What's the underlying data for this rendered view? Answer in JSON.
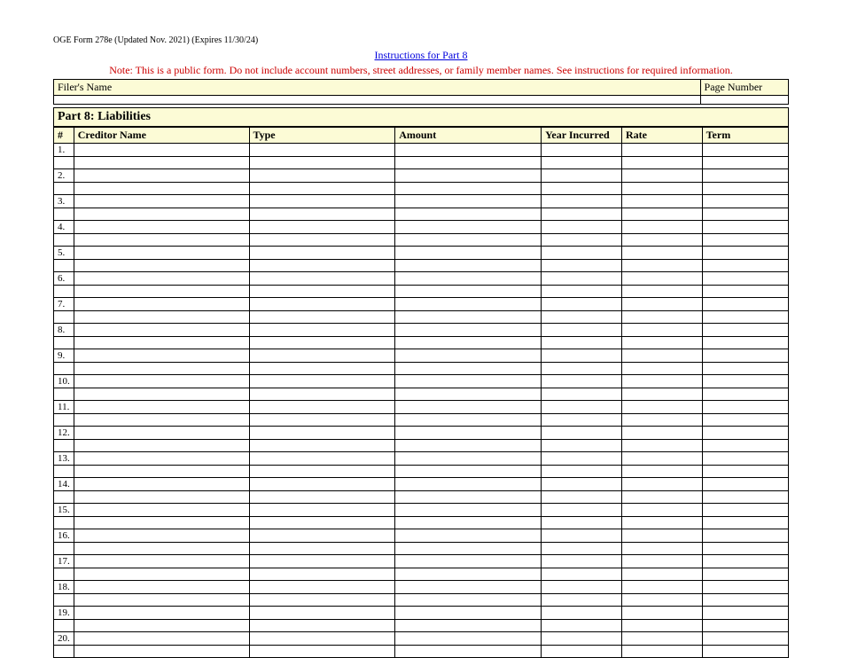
{
  "header": {
    "form_meta": "OGE Form 278e (Updated Nov. 2021) (Expires 11/30/24)",
    "instructions_link": "Instructions for Part 8",
    "note": "Note: This is a public form. Do not include account numbers, street addresses, or family member names.  See instructions for required information."
  },
  "filer_section": {
    "filer_name_label": "Filer's Name",
    "page_number_label": "Page Number",
    "filer_name_value": "",
    "page_number_value": ""
  },
  "section": {
    "title": "Part 8: Liabilities"
  },
  "columns": {
    "num": "#",
    "creditor": "Creditor Name",
    "type": "Type",
    "amount": "Amount",
    "year": "Year Incurred",
    "rate": "Rate",
    "term": "Term"
  },
  "rows": [
    {
      "num": "1.",
      "creditor": "",
      "type": "",
      "amount": "",
      "year": "",
      "rate": "",
      "term": ""
    },
    {
      "num": "2.",
      "creditor": "",
      "type": "",
      "amount": "",
      "year": "",
      "rate": "",
      "term": ""
    },
    {
      "num": "3.",
      "creditor": "",
      "type": "",
      "amount": "",
      "year": "",
      "rate": "",
      "term": ""
    },
    {
      "num": "4.",
      "creditor": "",
      "type": "",
      "amount": "",
      "year": "",
      "rate": "",
      "term": ""
    },
    {
      "num": "5.",
      "creditor": "",
      "type": "",
      "amount": "",
      "year": "",
      "rate": "",
      "term": ""
    },
    {
      "num": "6.",
      "creditor": "",
      "type": "",
      "amount": "",
      "year": "",
      "rate": "",
      "term": ""
    },
    {
      "num": "7.",
      "creditor": "",
      "type": "",
      "amount": "",
      "year": "",
      "rate": "",
      "term": ""
    },
    {
      "num": "8.",
      "creditor": "",
      "type": "",
      "amount": "",
      "year": "",
      "rate": "",
      "term": ""
    },
    {
      "num": "9.",
      "creditor": "",
      "type": "",
      "amount": "",
      "year": "",
      "rate": "",
      "term": ""
    },
    {
      "num": "10.",
      "creditor": "",
      "type": "",
      "amount": "",
      "year": "",
      "rate": "",
      "term": ""
    },
    {
      "num": "11.",
      "creditor": "",
      "type": "",
      "amount": "",
      "year": "",
      "rate": "",
      "term": ""
    },
    {
      "num": "12.",
      "creditor": "",
      "type": "",
      "amount": "",
      "year": "",
      "rate": "",
      "term": ""
    },
    {
      "num": "13.",
      "creditor": "",
      "type": "",
      "amount": "",
      "year": "",
      "rate": "",
      "term": ""
    },
    {
      "num": "14.",
      "creditor": "",
      "type": "",
      "amount": "",
      "year": "",
      "rate": "",
      "term": ""
    },
    {
      "num": "15.",
      "creditor": "",
      "type": "",
      "amount": "",
      "year": "",
      "rate": "",
      "term": ""
    },
    {
      "num": "16.",
      "creditor": "",
      "type": "",
      "amount": "",
      "year": "",
      "rate": "",
      "term": ""
    },
    {
      "num": "17.",
      "creditor": "",
      "type": "",
      "amount": "",
      "year": "",
      "rate": "",
      "term": ""
    },
    {
      "num": "18.",
      "creditor": "",
      "type": "",
      "amount": "",
      "year": "",
      "rate": "",
      "term": ""
    },
    {
      "num": "19.",
      "creditor": "",
      "type": "",
      "amount": "",
      "year": "",
      "rate": "",
      "term": ""
    },
    {
      "num": "20.",
      "creditor": "",
      "type": "",
      "amount": "",
      "year": "",
      "rate": "",
      "term": ""
    }
  ]
}
